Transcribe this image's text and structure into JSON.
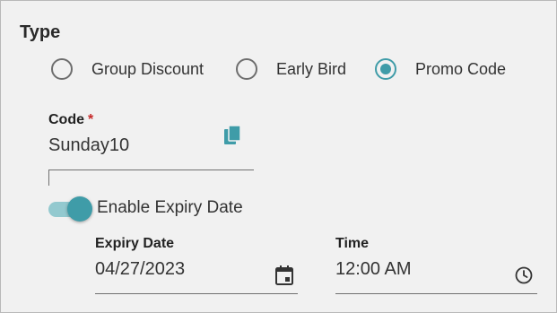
{
  "type_section": {
    "title": "Type",
    "options": [
      {
        "label": "Group Discount",
        "selected": false
      },
      {
        "label": "Early Bird",
        "selected": false
      },
      {
        "label": "Promo Code",
        "selected": true
      }
    ]
  },
  "code_field": {
    "label": "Code",
    "required_mark": "*",
    "value": "Sunday10",
    "icon": "copy-icon"
  },
  "expiry_toggle": {
    "label": "Enable Expiry Date",
    "enabled": true
  },
  "expiry_date_field": {
    "label": "Expiry Date",
    "value": "04/27/2023",
    "icon": "calendar-icon"
  },
  "time_field": {
    "label": "Time",
    "value": "12:00 AM",
    "icon": "clock-icon"
  },
  "colors": {
    "accent": "#3f9ca8",
    "accent_light": "#93c9cf",
    "required": "#c62828",
    "panel_bg": "#f1f1f1"
  }
}
